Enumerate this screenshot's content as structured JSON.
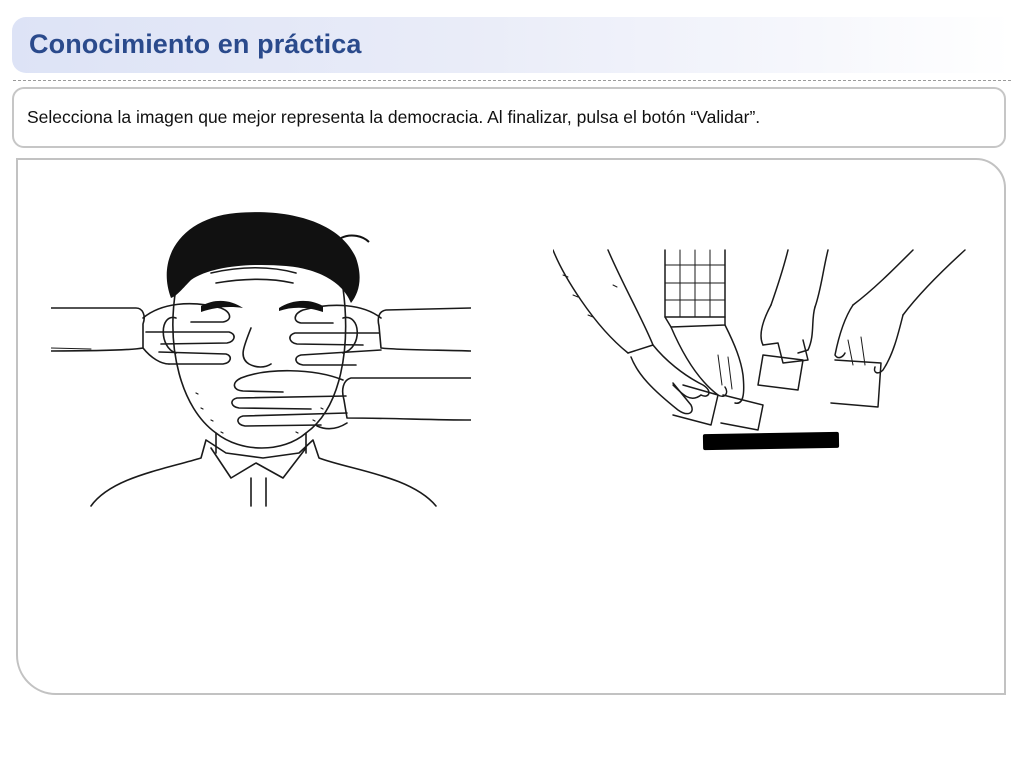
{
  "header": {
    "title": "Conocimiento en práctica"
  },
  "instruction": {
    "text": "Selecciona la imagen que mejor representa la democracia. Al finalizar, pulsa el botón “Validar”."
  },
  "options": [
    {
      "id": "option-censorship",
      "icon": "censored-man-illustration"
    },
    {
      "id": "option-voting",
      "icon": "hands-casting-votes-illustration"
    }
  ]
}
